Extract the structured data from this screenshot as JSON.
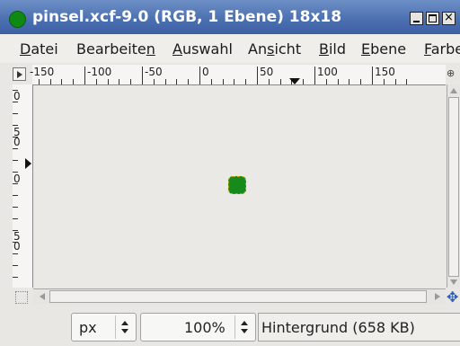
{
  "window": {
    "title": "pinsel.xcf-9.0 (RGB, 1 Ebene) 18x18",
    "controls": {
      "minimize": "_",
      "maximize": "□",
      "close": "×"
    }
  },
  "menu": {
    "items": [
      {
        "label": "Datei",
        "mnemonic": "D"
      },
      {
        "label": "Bearbeiten",
        "mnemonic": "n"
      },
      {
        "label": "Auswahl",
        "mnemonic": "A"
      },
      {
        "label": "Ansicht",
        "mnemonic": "s"
      },
      {
        "label": "Bild",
        "mnemonic": "B"
      },
      {
        "label": "Ebene",
        "mnemonic": "E"
      },
      {
        "label": "Farbe",
        "mnemonic": "F"
      }
    ]
  },
  "rulers": {
    "horizontal_labels": [
      "-150",
      "-100",
      "-50",
      "0",
      "50",
      "100",
      "150"
    ],
    "vertical_labels": [
      "0",
      "50",
      "0",
      "50"
    ]
  },
  "icons": {
    "ruler_menu": "triangle-right-icon",
    "navigate": "navigate-icon",
    "quick_mask": "quick-mask-icon",
    "move": "move-arrows-icon"
  },
  "statusbar": {
    "unit": "px",
    "zoom": "100%",
    "status_text": "Hintergrund (658 KB)"
  },
  "colors": {
    "titlebar": "#4a6fb0",
    "image_fill": "#168a1a",
    "canvas_bg": "#ebe9e5"
  }
}
